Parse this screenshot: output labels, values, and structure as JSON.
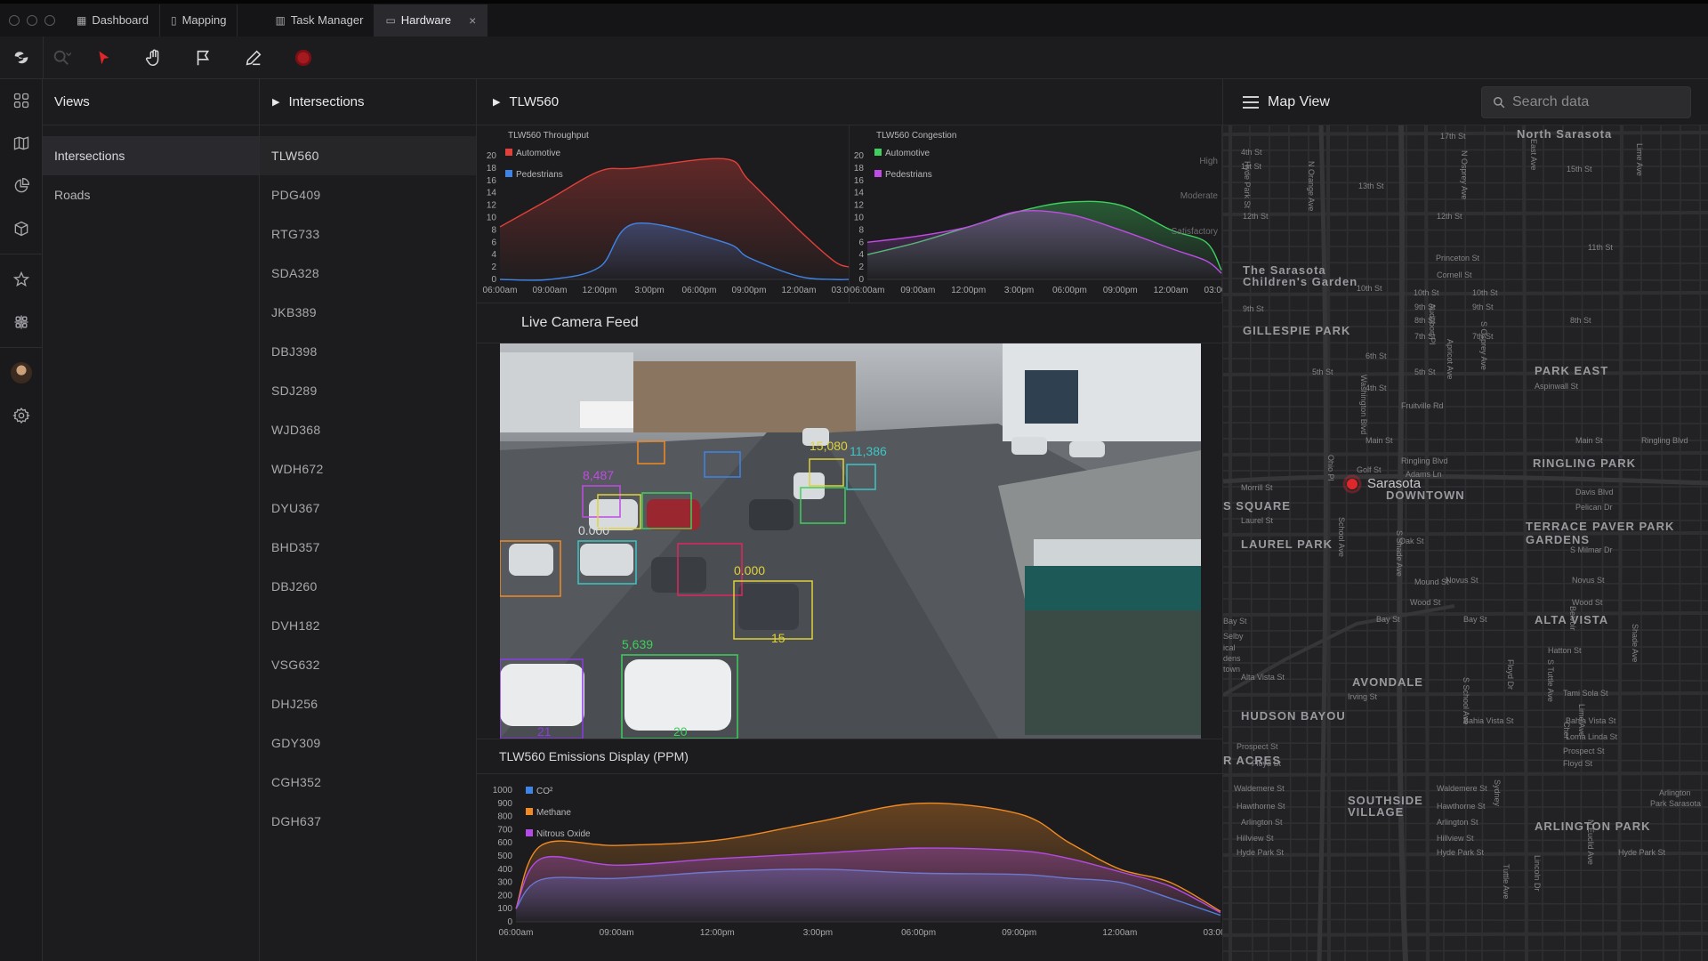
{
  "tabs": [
    {
      "label": "Dashboard",
      "icon": "grid-icon"
    },
    {
      "label": "Mapping",
      "icon": "book-icon"
    },
    {
      "label": "Task Manager",
      "icon": "columns-icon"
    },
    {
      "label": "Hardware",
      "icon": "hardware-icon",
      "active": true,
      "close": "×"
    }
  ],
  "toolbar": {
    "tools": [
      "logo",
      "zoom-tool",
      "select-tool",
      "hand-tool",
      "flag-tool",
      "edit-tool",
      "record-button"
    ],
    "accent": "#e0262b"
  },
  "rail": {
    "icons": [
      "grid-icon",
      "map-icon",
      "pie-chart-icon",
      "cube-icon",
      "star-icon",
      "network-icon",
      "avatar",
      "settings-icon"
    ]
  },
  "views": {
    "title": "Views",
    "items": [
      "Intersections",
      "Roads"
    ]
  },
  "intersections": {
    "title": "Intersections",
    "items": [
      "TLW560",
      "PDG409",
      "RTG733",
      "SDA328",
      "JKB389",
      "DBJ398",
      "SDJ289",
      "WJD368",
      "WDH672",
      "DYU367",
      "BHD357",
      "DBJ260",
      "DVH182",
      "VSG632",
      "DHJ256",
      "GDY309",
      "CGH352",
      "DGH637"
    ]
  },
  "main": {
    "title": "TLW560",
    "camera_title": "Live Camera Feed",
    "emissions_title": "TLW560 Emissions Display (PPM)"
  },
  "map": {
    "title": "Map View",
    "search_placeholder": "Search data",
    "marker_label": "Sarasota",
    "labels": [
      "North Sarasota",
      "17th St",
      "4th St",
      "1st St",
      "13th St",
      "15th St",
      "12th St",
      "12th St",
      "11th St",
      "Princeton St",
      "Cornell St",
      "The Sarasota",
      "Children's Garden",
      "10th St",
      "10th St",
      "10th St",
      "9th St",
      "9th St",
      "9th St",
      "8th St",
      "8th St",
      "7th St",
      "7th St",
      "GILLESPIE PARK",
      "6th St",
      "5th St",
      "5th St",
      "4th St",
      "PARK EAST",
      "Aspinwall St",
      "Fruitville Rd",
      "Main St",
      "Main St",
      "Ringling Blvd",
      "RINGLING PARK",
      "Ringling Blvd",
      "Adams Ln",
      "Golf St",
      "Morrill St",
      "DOWNTOWN",
      "Davis Blvd",
      "Pelican Dr",
      "S SQUARE",
      "Laurel St",
      "TERRACE",
      "GARDENS",
      "PAVER PARK",
      "LAUREL PARK",
      "Oak St",
      "S Milmar Dr",
      "Novus St",
      "Novus St",
      "Mound St",
      "Wood St",
      "Wood St",
      "Bay St",
      "Bay St",
      "Bay St",
      "ALTA VISTA",
      "Selby",
      "ical",
      "dens",
      "town",
      "Hatton St",
      "Alta Vista St",
      "AVONDALE",
      "Irving St",
      "Tami Sola St",
      "HUDSON BAYOU",
      "Bahia Vista St",
      "Bahia Vista St",
      "Loma Linda St",
      "Prospect St",
      "Prospect St",
      "R ACRES",
      "Floyd St",
      "Floyd St",
      "Waldemere St",
      "Waldemere St",
      "SOUTHSIDE",
      "VILLAGE",
      "Arlington",
      "Park Sarasota",
      "Hawthorne St",
      "Hawthorne St",
      "Arlington St",
      "Arlington St",
      "ARLINGTON PARK",
      "Hillview St",
      "Hillview St",
      "Hyde Park St",
      "Hyde Park St",
      "Hyde Park St",
      "N Orange Ave",
      "N Osprey Ave",
      "East Ave",
      "Lime Ave",
      "Washington Blvd",
      "Audubon Pl",
      "Apricot Ave",
      "S Osprey Ave",
      "Ohio Pl",
      "School Ave",
      "S Shade Ave",
      "Lime Ave",
      "Shade Ave",
      "Floyd Dr",
      "S School Ave",
      "S Tuttle Ave",
      "Belvoir",
      "Sydney",
      "Cher",
      "Tuttle Ave",
      "N Euclid Ave",
      "Lincoln Dr"
    ]
  },
  "chart_data": [
    {
      "type": "area",
      "title": "TLW560 Throughput",
      "x": [
        "06:00am",
        "09:00am",
        "12:00pm",
        "3:00pm",
        "06:00pm",
        "09:00pm",
        "12:00am",
        "03:00am"
      ],
      "ylim": [
        0,
        20
      ],
      "yticks": [
        0,
        2,
        4,
        6,
        8,
        10,
        12,
        14,
        16,
        18,
        20
      ],
      "series": [
        {
          "name": "Automotive",
          "color": "#e2403a",
          "values": [
            8.5,
            13,
            17.5,
            18,
            19.5,
            16,
            8,
            3,
            2
          ]
        },
        {
          "name": "Pedestrians",
          "color": "#3f84e5",
          "values": [
            0,
            0,
            2,
            9,
            6,
            3.5,
            0.5,
            0,
            0
          ]
        }
      ],
      "sample_x": [
        0,
        1,
        2,
        2.7,
        4.5,
        5,
        6,
        6.7,
        7
      ]
    },
    {
      "type": "area",
      "title": "TLW560 Congestion",
      "x": [
        "06:00am",
        "09:00am",
        "12:00pm",
        "3:00pm",
        "06:00pm",
        "09:00pm",
        "12:00am",
        "03:00am"
      ],
      "ylim": [
        0,
        20
      ],
      "yticks": [
        0,
        2,
        4,
        6,
        8,
        10,
        12,
        14,
        16,
        18,
        20
      ],
      "levels": [
        "High",
        "Moderate",
        "Satisfactory"
      ],
      "series": [
        {
          "name": "Automotive",
          "color": "#3ecf5c",
          "values": [
            4,
            6,
            8.5,
            11,
            12.5,
            12,
            8,
            6,
            1.5
          ]
        },
        {
          "name": "Pedestrians",
          "color": "#c14be6",
          "values": [
            6,
            7,
            8.5,
            11,
            10.5,
            8,
            5,
            3,
            1
          ]
        }
      ],
      "sample_x": [
        0,
        1,
        2,
        3,
        4,
        5,
        6,
        6.7,
        7
      ]
    },
    {
      "type": "area",
      "title": "TLW560 Emissions Display (PPM)",
      "x": [
        "06:00am",
        "09:00am",
        "12:00pm",
        "3:00pm",
        "06:00pm",
        "09:00pm",
        "12:00am",
        "03:00am"
      ],
      "ylim": [
        0,
        1000
      ],
      "yticks": [
        0,
        100,
        200,
        300,
        400,
        500,
        600,
        700,
        800,
        900,
        1000
      ],
      "series": [
        {
          "name": "CO²",
          "color": "#3f84e5",
          "values": [
            100,
            320,
            330,
            380,
            400,
            370,
            360,
            330,
            300,
            180,
            50
          ]
        },
        {
          "name": "Methane",
          "color": "#f08a24",
          "values": [
            100,
            580,
            580,
            620,
            760,
            900,
            820,
            600,
            400,
            300,
            80
          ]
        },
        {
          "name": "Nitrous Oxide",
          "color": "#b34be6",
          "values": [
            100,
            480,
            430,
            480,
            520,
            560,
            540,
            480,
            380,
            270,
            70
          ]
        }
      ],
      "sample_x": [
        0,
        0.25,
        1,
        2,
        3,
        4,
        5,
        5.5,
        6,
        6.5,
        7
      ]
    }
  ]
}
